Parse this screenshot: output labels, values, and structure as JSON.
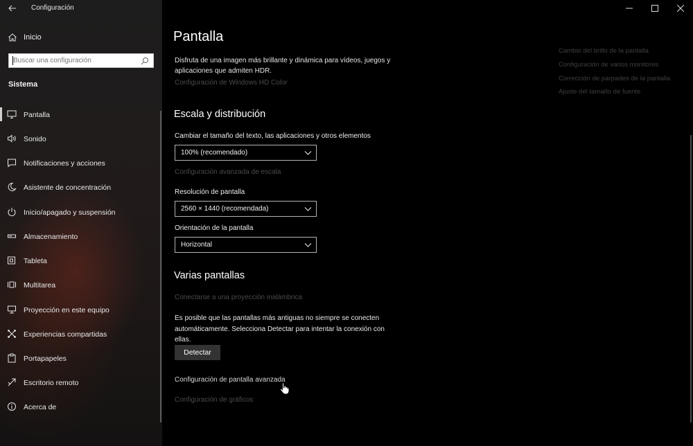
{
  "window": {
    "app_title": "Configuración",
    "controls": [
      "minimize-icon",
      "maximize-icon",
      "close-icon"
    ]
  },
  "sidebar": {
    "home_label": "Inicio",
    "search": {
      "placeholder": "Buscar una configuración",
      "value": ""
    },
    "section_label": "Sistema",
    "selected_index": 0,
    "items": [
      {
        "label": "Pantalla",
        "icon": "monitor-icon"
      },
      {
        "label": "Sonido",
        "icon": "speaker-icon"
      },
      {
        "label": "Notificaciones y acciones",
        "icon": "notification-icon"
      },
      {
        "label": "Asistente de concentración",
        "icon": "moon-icon"
      },
      {
        "label": "Inicio/apagado y suspensión",
        "icon": "power-icon"
      },
      {
        "label": "Almacenamiento",
        "icon": "storage-icon"
      },
      {
        "label": "Tableta",
        "icon": "tablet-icon"
      },
      {
        "label": "Multitarea",
        "icon": "multitask-icon"
      },
      {
        "label": "Proyección en este equipo",
        "icon": "projection-icon"
      },
      {
        "label": "Experiencias compartidas",
        "icon": "shared-icon"
      },
      {
        "label": "Portapapeles",
        "icon": "clipboard-icon"
      },
      {
        "label": "Escritorio remoto",
        "icon": "remote-icon"
      },
      {
        "label": "Acerca de",
        "icon": "info-icon"
      }
    ]
  },
  "main": {
    "title": "Pantalla",
    "hdr_description": "Disfruta de una imagen más brillante y dinámica para vídeos, juegos y aplicaciones que admiten HDR.",
    "hdr_link": "Configuración de Windows HD Color",
    "scale_section": {
      "heading": "Escala y distribución",
      "scale_label": "Cambiar el tamaño del texto, las aplicaciones y otros elementos",
      "scale_value": "100% (recomendado)",
      "advanced_scale_link": "Configuración avanzada de escala",
      "resolution_label": "Resolución de pantalla",
      "resolution_value": "2560 × 1440 (recomendada)",
      "orientation_label": "Orientación de la pantalla",
      "orientation_value": "Horizontal"
    },
    "multi_section": {
      "heading": "Varias pantallas",
      "wireless_link": "Conectarse a una proyección inalámbrica",
      "info_text": "Es posible que las pantallas más antiguas no siempre se conecten automáticamente. Selecciona Detectar para intentar la conexión con ellas.",
      "detect_button": "Detectar",
      "advanced_display_link": "Configuración de pantalla avanzada",
      "graphics_link": "Configuración de gráficos"
    },
    "related_links": [
      "Cambio del brillo de la pantalla",
      "Configuración de varios monitores",
      "Corrección de parpadeo de la pantalla",
      "Ajuste del tamaño de fuente"
    ]
  }
}
